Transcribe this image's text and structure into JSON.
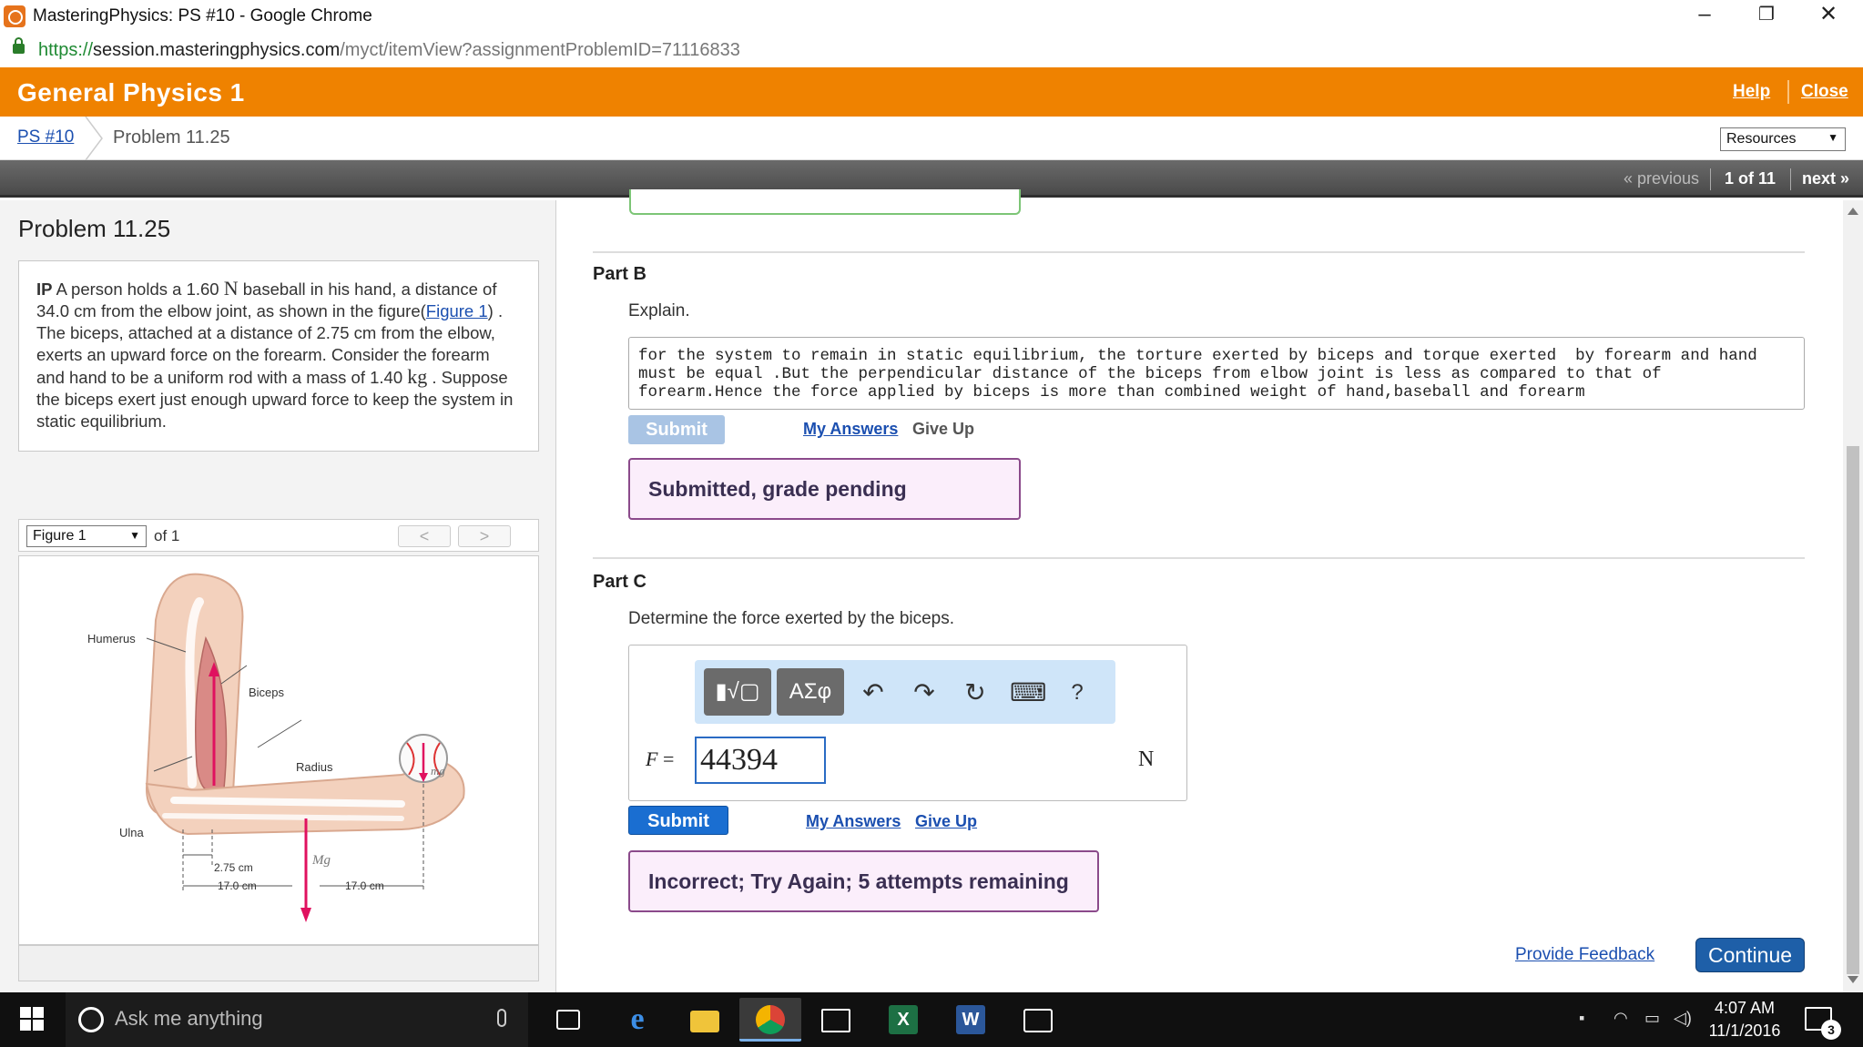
{
  "window": {
    "title": "MasteringPhysics: PS #10 - Google Chrome",
    "controls": {
      "minimize": "–",
      "restore": "❐",
      "close": "✕"
    }
  },
  "address": {
    "scheme": "https://",
    "host": "session.masteringphysics.com",
    "path": "/myct/itemView?assignmentProblemID=71116833"
  },
  "header": {
    "course": "General Physics 1",
    "help": "Help",
    "close": "Close"
  },
  "breadcrumb": {
    "assignment": "PS #10",
    "current": "Problem 11.25",
    "resources": "Resources"
  },
  "nav": {
    "previous": "« previous",
    "position": "1 of 11",
    "next": "next »"
  },
  "problem": {
    "title": "Problem 11.25",
    "ip": "IP",
    "text_1": " A person holds a 1.60 ",
    "unit_N": "N",
    "text_2": " baseball in his hand, a distance of 34.0 cm from the elbow joint, as shown in the figure(",
    "figure_link": "Figure 1",
    "text_3": ") . The biceps, attached at a distance of 2.75 cm from the elbow, exerts an upward force on the forearm. Consider the forearm and hand to be a uniform rod with a mass of 1.40 ",
    "unit_kg": "kg",
    "text_4": " . Suppose the biceps exert just enough upward force to keep the system in static equilibrium."
  },
  "figure": {
    "select": "Figure 1",
    "of": "of 1",
    "prev": "<",
    "next": ">",
    "labels": {
      "humerus": "Humerus",
      "biceps": "Biceps",
      "radius": "Radius",
      "ulna": "Ulna",
      "mg_ball": "mg",
      "mg_arm": "Mg",
      "d1": "2.75 cm",
      "d2": "17.0 cm",
      "d3": "17.0 cm"
    }
  },
  "partB": {
    "title": "Part B",
    "prompt": "Explain.",
    "answer": "for the system to remain in static equilibrium, the torture exerted by biceps and torque exerted  by forearm and hand must be equal .But the perpendicular distance of the biceps from elbow joint is less as compared to that of forearm.Hence the force applied by biceps is more than combined weight of hand,baseball and forearm",
    "submit": "Submit",
    "my_answers": "My Answers",
    "give_up": "Give Up",
    "status": "Submitted, grade pending"
  },
  "partC": {
    "title": "Part C",
    "prompt": "Determine the force exerted by the biceps.",
    "toolbar": {
      "templates": "▮√▢",
      "symbols": "ΑΣφ",
      "undo": "↶",
      "redo": "↷",
      "reset": "↻",
      "keyboard": "⌨",
      "help": "?"
    },
    "variable": "F",
    "equals": " =",
    "answer": "44394",
    "unit": "N",
    "submit": "Submit",
    "my_answers": "My Answers",
    "give_up": "Give Up",
    "status": "Incorrect; Try Again; 5 attempts remaining"
  },
  "footer": {
    "feedback": "Provide Feedback",
    "continue": "Continue"
  },
  "taskbar": {
    "search_placeholder": "Ask me anything",
    "time": "4:07 AM",
    "date": "11/1/2016",
    "notifications": "3"
  }
}
